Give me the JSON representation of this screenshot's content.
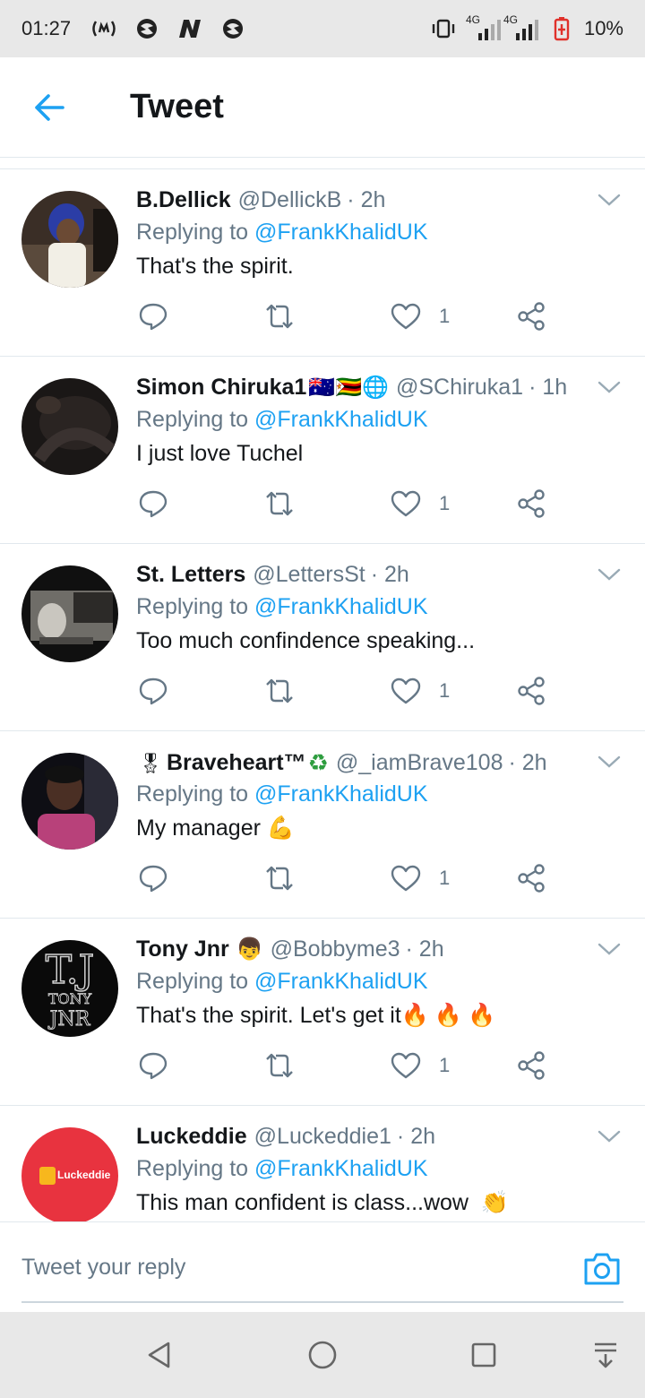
{
  "status_bar": {
    "time": "01:27",
    "network_label_1": "4G",
    "network_label_2": "4G",
    "battery": "10%",
    "icons": [
      "nfc-radio-icon",
      "app-icon-1",
      "app-icon-n",
      "app-icon-2",
      "vibrate-icon",
      "signal-icon",
      "battery-low-icon"
    ]
  },
  "header": {
    "title": "Tweet"
  },
  "replying_prefix": "Replying to",
  "tweets": [
    {
      "name": "B.Dellick",
      "handle": "@DellickB",
      "time": "· 2h",
      "reply_to": "@FrankKhalidUK",
      "text": "That's the spirit.",
      "likes": "1",
      "name_emojis": "",
      "text_emojis": ""
    },
    {
      "name": "Simon Chiruka1",
      "handle": "@SChiruka1",
      "time": "· 1h",
      "reply_to": "@FrankKhalidUK",
      "text": "I just love Tuchel",
      "likes": "1",
      "name_emojis": "🇦🇺🇿🇼🌐",
      "text_emojis": ""
    },
    {
      "name": "St. Letters",
      "handle": "@LettersSt",
      "time": "· 2h",
      "reply_to": "@FrankKhalidUK",
      "text": "Too much confindence speaking...",
      "likes": "1",
      "name_emojis": "",
      "text_emojis": ""
    },
    {
      "name": "Braveheart™",
      "handle": "@_iamBrave108",
      "time": "· 2h",
      "reply_to": "@FrankKhalidUK",
      "text": "My manager",
      "likes": "1",
      "name_prefix_emoji": "🎖",
      "name_emojis": "♻",
      "text_emojis": "💪"
    },
    {
      "name": "Tony Jnr",
      "handle": "@Bobbyme3",
      "time": "· 2h",
      "reply_to": "@FrankKhalidUK",
      "text": "That's the spirit. Let's get it",
      "likes": "1",
      "name_emojis": "👦",
      "text_emojis": "🔥🔥🔥",
      "avatar_text": "T.J",
      "avatar_sub1": "TONY",
      "avatar_sub2": "JNR"
    },
    {
      "name": "Luckeddie",
      "handle": "@Luckeddie1",
      "time": "· 2h",
      "reply_to": "@FrankKhalidUK",
      "text": "This man confident is class...wow",
      "likes": "",
      "name_emojis": "",
      "text_emojis": "👏",
      "avatar_text": "Luckeddie"
    }
  ],
  "reply_bar": {
    "placeholder": "Tweet your reply"
  },
  "colors": {
    "accent": "#1da1f2",
    "text": "#14171a",
    "muted": "#657786",
    "divider": "#e1e8ed",
    "statusbar": "#e8e8e8"
  }
}
